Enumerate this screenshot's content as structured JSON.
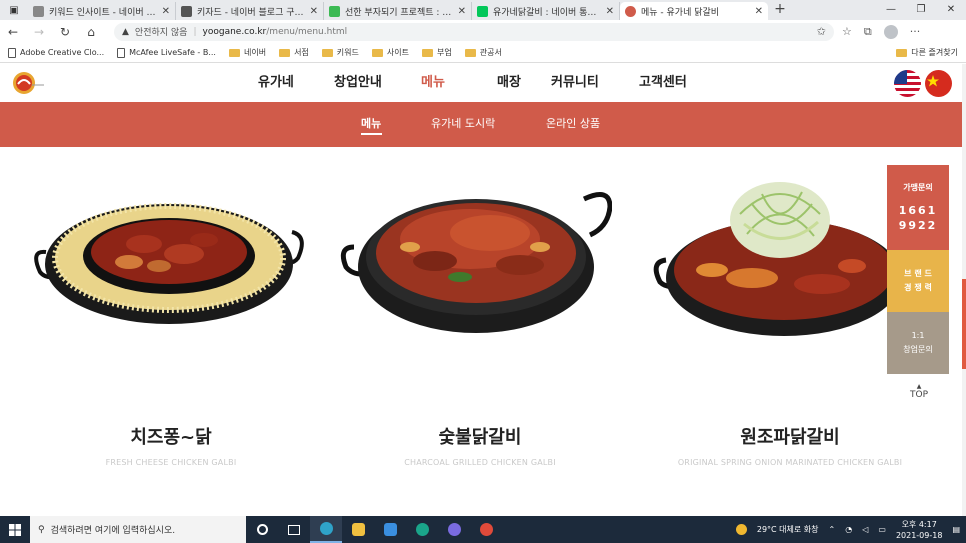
{
  "browser": {
    "tabs": [
      {
        "title": "키워드 인사이트 - 네이버 키워드",
        "active": false,
        "color": "#888888"
      },
      {
        "title": "키자드 - 네이버 블로그 구글 검색",
        "active": false,
        "color": "#555555"
      },
      {
        "title": "선한 부자되기 프로젝트 : 네이버",
        "active": false,
        "color": "#3cba54"
      },
      {
        "title": "유가네닭갈비 : 네이버 통합검색",
        "active": false,
        "color": "#03c75a"
      },
      {
        "title": "메뉴 - 유가네 닭갈비",
        "active": true,
        "color": "#d05b4a"
      }
    ],
    "close_glyph": "✕",
    "new_tab": "+",
    "window_controls": [
      "—",
      "❐",
      "✕"
    ],
    "nav": {
      "back": "←",
      "forward": "→",
      "reload": "↻",
      "home": "⌂"
    },
    "address": {
      "security": "안전하지 않음",
      "separator": "|",
      "host": "yoogane.co.kr",
      "path": "/menu/menu.html"
    },
    "toolbar_icons": [
      "✩",
      "☆",
      "⧉"
    ],
    "more": "···",
    "bookmarks": [
      {
        "label": "Adobe Creative Clo...",
        "type": "page"
      },
      {
        "label": "McAfee LiveSafe - B...",
        "type": "page"
      },
      {
        "label": "네이버",
        "type": "folder"
      },
      {
        "label": "서점",
        "type": "folder"
      },
      {
        "label": "키워드",
        "type": "folder"
      },
      {
        "label": "사이트",
        "type": "folder"
      },
      {
        "label": "부업",
        "type": "folder"
      },
      {
        "label": "관공서",
        "type": "folder"
      }
    ],
    "other_bookmarks": "다른 즐겨찾기"
  },
  "site": {
    "gnb": [
      "유가네",
      "창업안내",
      "메뉴",
      "매장",
      "커뮤니티",
      "고객센터"
    ],
    "gnb_active": "메뉴",
    "accent": "#d05b4a",
    "subnav": [
      "메뉴",
      "유가네 도시락",
      "온라인 상품"
    ],
    "menu": [
      {
        "name": "치즈퐁~닭",
        "eng": "FRESH CHEESE CHICKEN GALBI"
      },
      {
        "name": "숯불닭갈비",
        "eng": "CHARCOAL GRILLED CHICKEN GALBI"
      },
      {
        "name": "원조파닭갈비",
        "eng": "ORIGINAL SPRING ONION MARINATED CHICKEN GALBI"
      }
    ],
    "side": {
      "franchise_title": "가맹문의",
      "phone_1": "1661",
      "phone_2": "9922",
      "brand_1": "브 랜 드",
      "brand_2": "경 쟁 력",
      "consult_1": "1:1",
      "consult_2": "창업문의",
      "top_arrow": "▲",
      "top": "TOP"
    }
  },
  "taskbar": {
    "search_placeholder": "검색하려면 여기에 입력하십시오.",
    "weather": "29°C  대체로 화창",
    "time": "오후 4:17",
    "date": "2021-09-18"
  }
}
